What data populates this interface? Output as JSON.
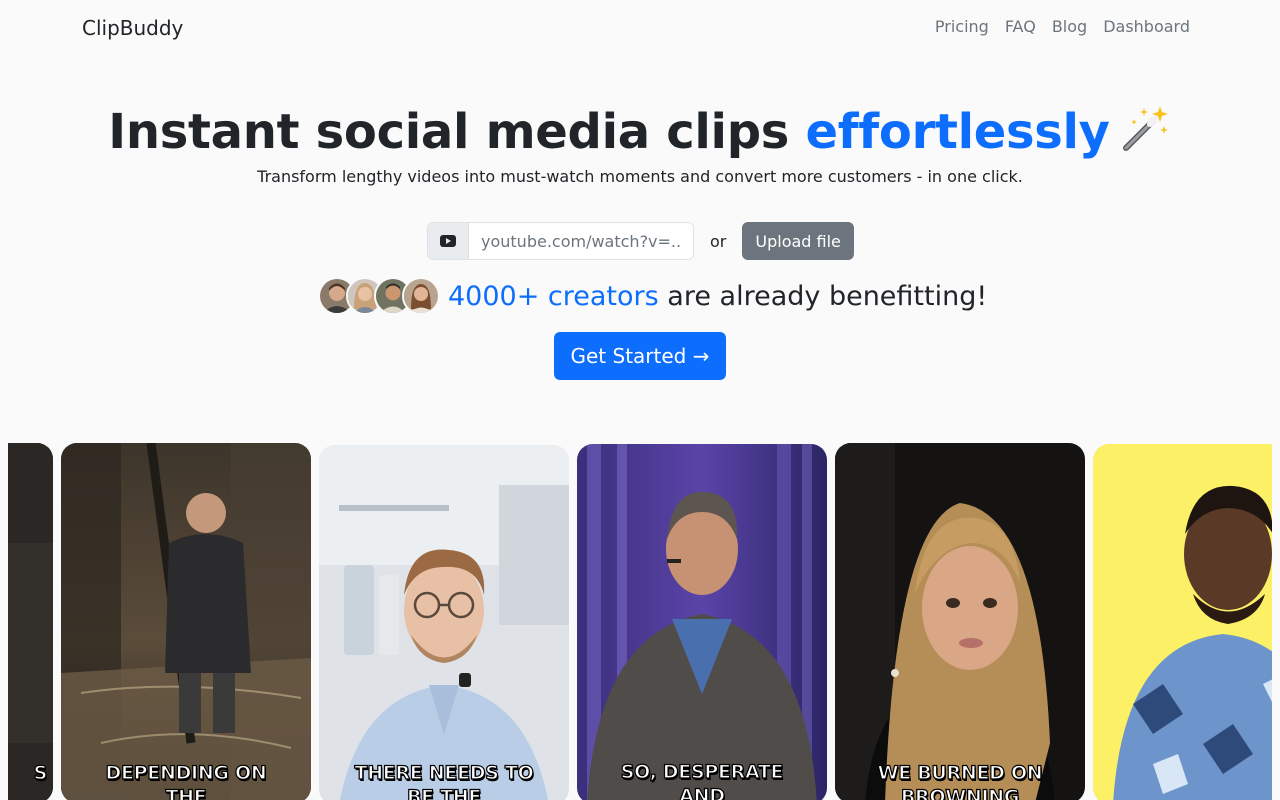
{
  "nav": {
    "brand": "ClipBuddy",
    "links": [
      "Pricing",
      "FAQ",
      "Blog",
      "Dashboard"
    ]
  },
  "hero": {
    "title_main": "Instant social media clips ",
    "title_accent": "effortlessly",
    "subtitle": "Transform lengthy videos into must-watch moments and convert more customers - in one click."
  },
  "input": {
    "placeholder": "youtube.com/watch?v=..",
    "or_label": "or",
    "upload_label": "Upload file"
  },
  "social_proof": {
    "accent": "4000+ creators",
    "rest": " are already benefitting!"
  },
  "cta": {
    "label": "Get Started →"
  },
  "clips": [
    {
      "caption": "S",
      "caption2": ""
    },
    {
      "caption": "DEPENDING ON",
      "caption2": "THE"
    },
    {
      "caption": "THERE NEEDS TO",
      "caption2": "BE THE"
    },
    {
      "caption": "SO, DESPERATE",
      "caption2": "AND"
    },
    {
      "caption": "WE BURNED ON",
      "caption2": "BROWNING"
    },
    {
      "caption": "",
      "caption2": ""
    }
  ],
  "colors": {
    "accent": "#0d6efd",
    "secondary": "#6c757d",
    "background": "#fafafa",
    "text": "#212529"
  }
}
